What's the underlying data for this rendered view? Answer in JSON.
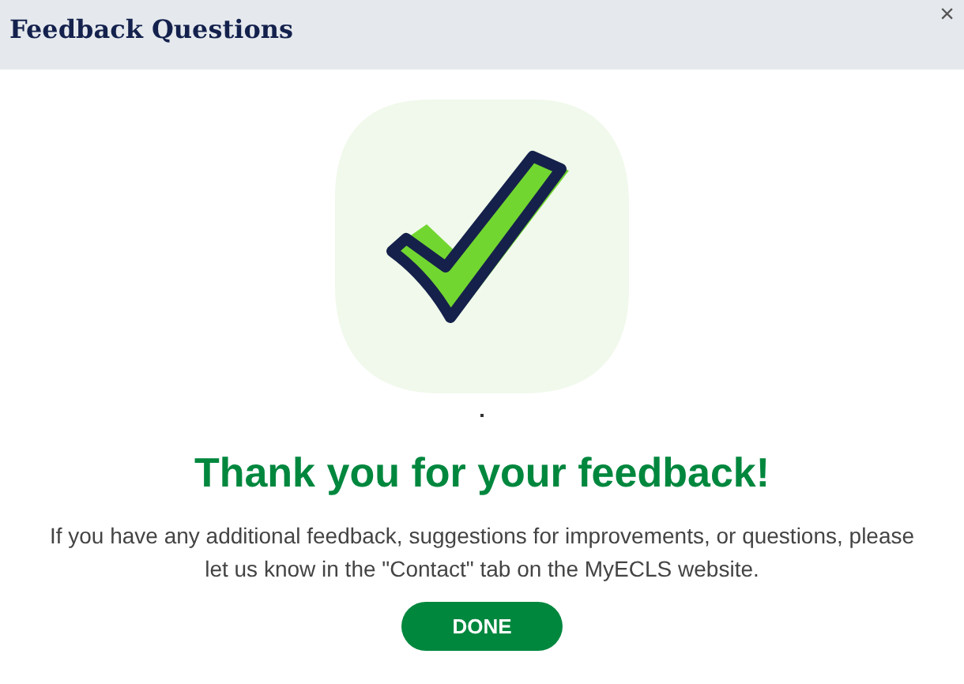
{
  "dialog": {
    "title": "Feedback Questions",
    "close": "×"
  },
  "illustration": {
    "kind": "checkmark"
  },
  "heading": "Thank you for your feedback!",
  "message": "If you have any additional feedback, suggestions for improvements, or questions, please let us know in the \"Contact\" tab on the MyECLS website.",
  "button": "DONE"
}
